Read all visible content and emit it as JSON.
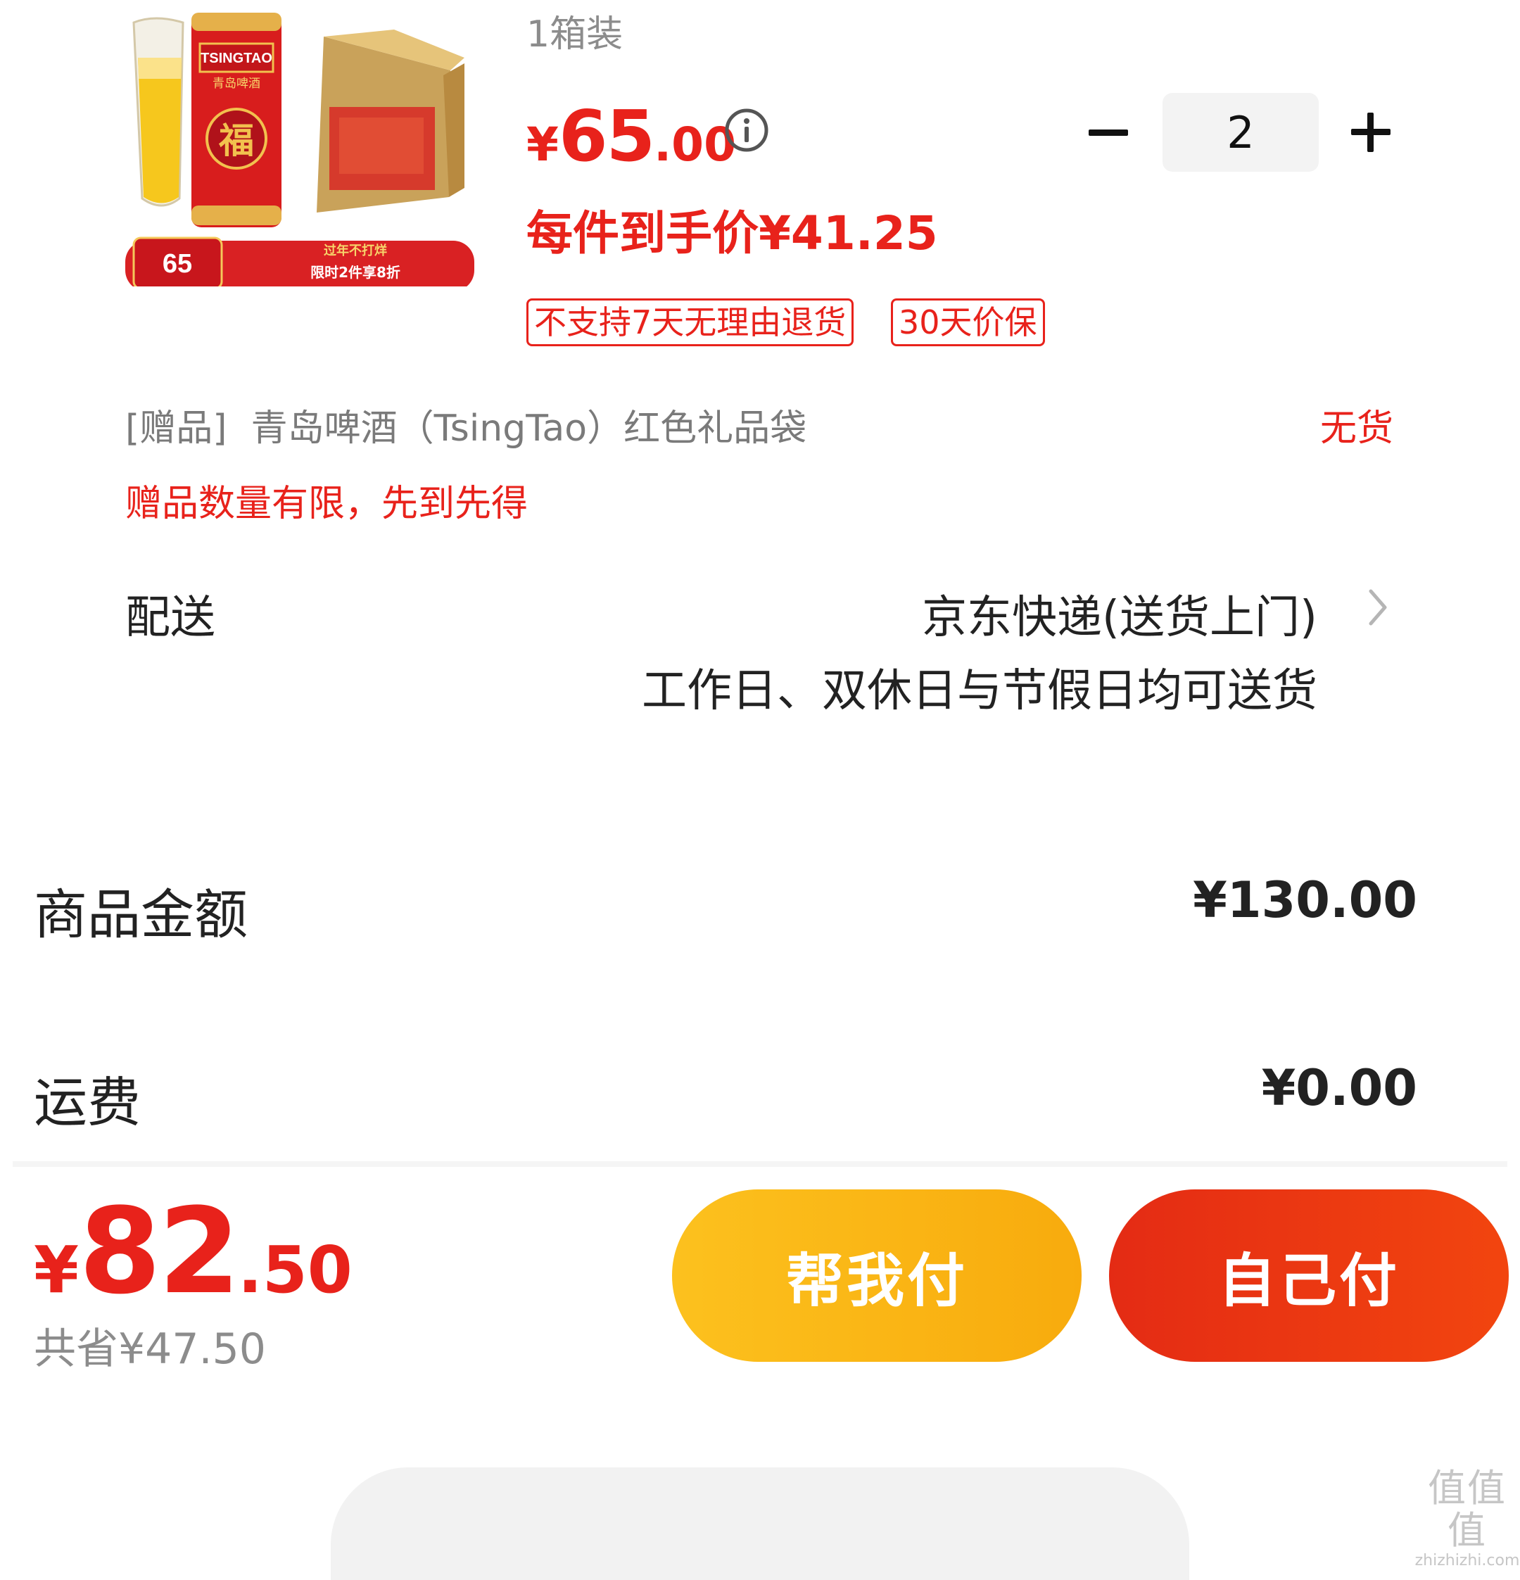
{
  "product": {
    "image_alt": "TSINGTAO 青岛啤酒 福 礼盒",
    "image_badges": {
      "brand": "TSINGTAO",
      "brand_cn": "青岛啤酒",
      "fu": "福",
      "price_badge": "65",
      "slogan": "过年不打烊",
      "promo": "限时2件享8折"
    },
    "pack": "1箱装",
    "price_currency": "¥",
    "price_integer": "65",
    "price_decimal": ".00",
    "unit_price_text": "每件到手价¥41.25",
    "quantity": "2",
    "tags": [
      "不支持7天无理由退货",
      "30天价保"
    ]
  },
  "gift": {
    "prefix": "[赠品]",
    "name": "青岛啤酒（TsingTao）红色礼品袋",
    "status": "无货",
    "notice": "赠品数量有限，先到先得"
  },
  "delivery": {
    "label": "配送",
    "method": "京东快递(送货上门)",
    "note": "工作日、双休日与节假日均可送货"
  },
  "summary": {
    "goods_label": "商品金额",
    "goods_value": "¥130.00",
    "shipping_label": "运费",
    "shipping_value": "¥0.00"
  },
  "footer": {
    "total_currency": "¥",
    "total_integer": "82",
    "total_decimal": ".50",
    "saved": "共省¥47.50",
    "help_pay_label": "帮我付",
    "self_pay_label": "自己付"
  },
  "watermark": {
    "logo": "值值值",
    "url": "zhizhizhi.com"
  },
  "colors": {
    "accent_red": "#e8221b",
    "help_button": "#f8ab0d",
    "self_button": "#ec3612"
  }
}
